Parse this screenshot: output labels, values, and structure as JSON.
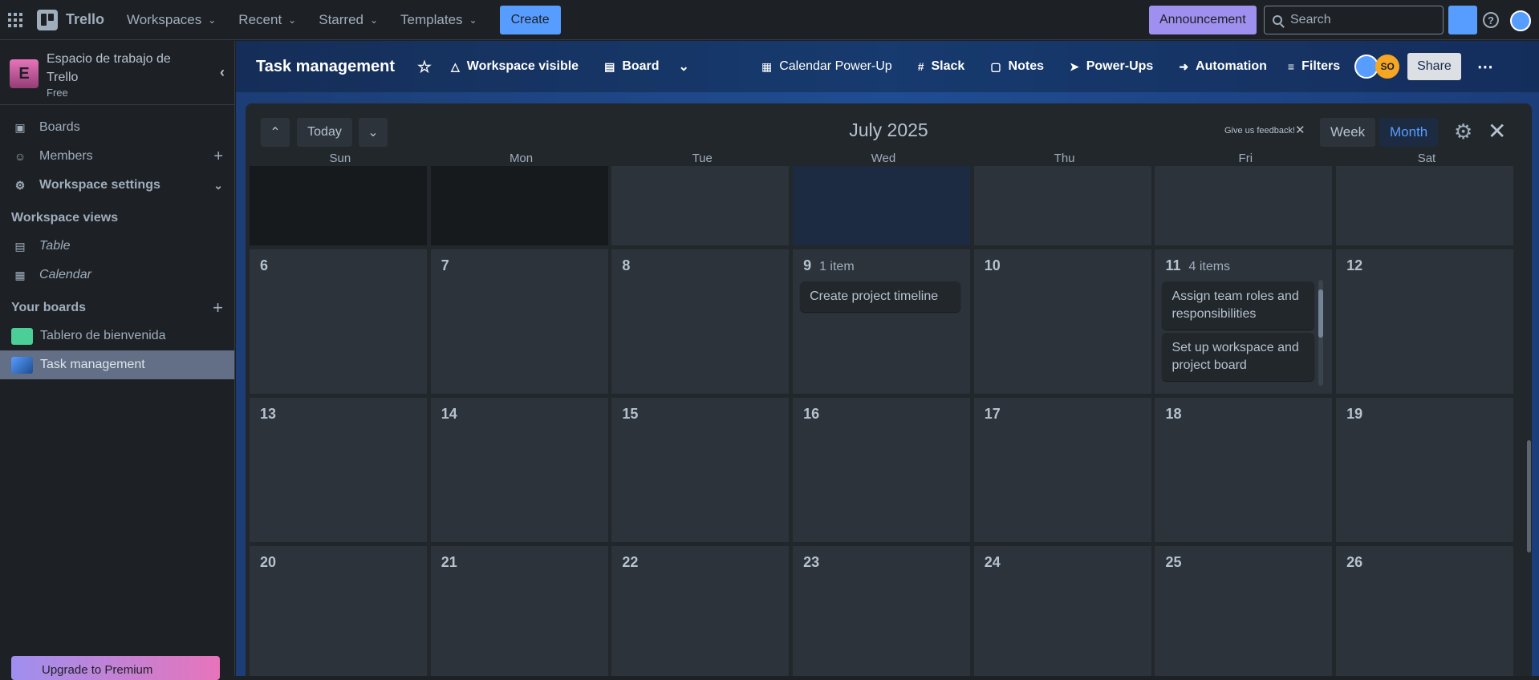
{
  "topbar": {
    "app_name": "Trello",
    "menus": [
      "Workspaces",
      "Recent",
      "Starred",
      "Templates"
    ],
    "create_label": "Create",
    "announcement_label": "Announcement",
    "search_placeholder": "Search"
  },
  "sidebar": {
    "workspace_name": "Espacio de trabajo de Trello",
    "workspace_initial": "E",
    "workspace_plan": "Free",
    "items": [
      {
        "label": "Boards",
        "icon": "trello-board-icon"
      },
      {
        "label": "Members",
        "icon": "person-icon"
      },
      {
        "label": "Workspace settings",
        "icon": "gear-icon"
      }
    ],
    "views_heading": "Workspace views",
    "views": [
      {
        "label": "Table",
        "icon": "table-icon"
      },
      {
        "label": "Calendar",
        "icon": "calendar-icon"
      }
    ],
    "boards_heading": "Your boards",
    "boards": [
      {
        "label": "Tablero de bienvenida",
        "color": "#4bce97"
      },
      {
        "label": "Task management",
        "color": "#579dff"
      }
    ],
    "upgrade_label": "Upgrade to Premium"
  },
  "board": {
    "title": "Task management",
    "visibility_label": "Workspace visible",
    "view_label": "Board",
    "powerups": [
      "Calendar Power-Up",
      "Slack",
      "Notes",
      "Power-Ups",
      "Automation",
      "Filters"
    ],
    "member_initials": "SO",
    "share_label": "Share"
  },
  "calendar": {
    "today_label": "Today",
    "title": "July 2025",
    "feedback_label": "Give us feedback!",
    "week_label": "Week",
    "month_label": "Month",
    "weekdays": [
      "Sun",
      "Mon",
      "Tue",
      "Wed",
      "Thu",
      "Fri",
      "Sat"
    ],
    "week2": [
      "6",
      "7",
      "8",
      "9",
      "10",
      "11",
      "12"
    ],
    "week3": [
      "13",
      "14",
      "15",
      "16",
      "17",
      "18",
      "19"
    ],
    "week4": [
      "20",
      "21",
      "22",
      "23",
      "24",
      "25",
      "26"
    ],
    "wed9_count": "1 item",
    "wed9_cards": [
      "Create project timeline"
    ],
    "fri11_count": "4 items",
    "fri11_cards": [
      "Assign team roles and responsibilities",
      "Set up workspace and project board"
    ]
  },
  "colors": {
    "accent": "#579dff",
    "announcement": "#9f8fef",
    "avatar_so": "#f5a623"
  }
}
